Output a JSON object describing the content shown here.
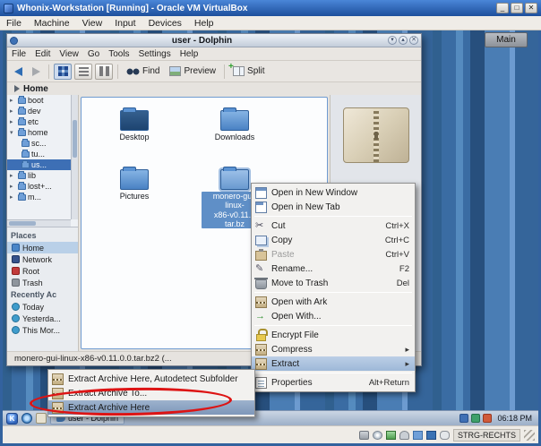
{
  "vbox": {
    "title": "Whonix-Workstation [Running] - Oracle VM VirtualBox",
    "menu": [
      "File",
      "Machine",
      "View",
      "Input",
      "Devices",
      "Help"
    ],
    "host_key": "STRG-RECHTS"
  },
  "desktop": {
    "main_button": "Main"
  },
  "dolphin": {
    "title": "user - Dolphin",
    "menu": [
      "File",
      "Edit",
      "View",
      "Go",
      "Tools",
      "Settings",
      "Help"
    ],
    "toolbar": {
      "find": "Find",
      "preview": "Preview",
      "split": "Split"
    },
    "breadcrumb": "Home",
    "tree": [
      {
        "label": "boot"
      },
      {
        "label": "dev"
      },
      {
        "label": "etc"
      },
      {
        "label": "home"
      },
      {
        "label": "sc..."
      },
      {
        "label": "tu..."
      },
      {
        "label": "us..."
      },
      {
        "label": "lib"
      },
      {
        "label": "lost+..."
      },
      {
        "label": "m..."
      }
    ],
    "places": {
      "header": "Places",
      "items": [
        "Home",
        "Network",
        "Root",
        "Trash"
      ],
      "recent_header": "Recently Ac",
      "recent_items": [
        "Today",
        "Yesterda...",
        "This Mor..."
      ]
    },
    "files": [
      {
        "label": "Desktop"
      },
      {
        "label": "Downloads"
      },
      {
        "label": "Pictures"
      },
      {
        "label": "monero-gui-linux-\nx86-v0.11...\ntar.bz"
      }
    ],
    "status": "monero-gui-linux-x86-v0.11.0.0.tar.bz2 (..."
  },
  "context_menu": {
    "items": [
      {
        "label": "Open in New Window"
      },
      {
        "label": "Open in New Tab"
      },
      {
        "separator": true
      },
      {
        "label": "Cut",
        "shortcut": "Ctrl+X"
      },
      {
        "label": "Copy",
        "shortcut": "Ctrl+C"
      },
      {
        "label": "Paste",
        "shortcut": "Ctrl+V",
        "disabled": true
      },
      {
        "label": "Rename...",
        "shortcut": "F2"
      },
      {
        "label": "Move to Trash",
        "shortcut": "Del"
      },
      {
        "separator": true
      },
      {
        "label": "Open with Ark"
      },
      {
        "label": "Open With..."
      },
      {
        "separator": true
      },
      {
        "label": "Encrypt File"
      },
      {
        "label": "Compress",
        "submenu": true
      },
      {
        "label": "Extract",
        "submenu": true,
        "highlighted": true
      },
      {
        "separator": true
      },
      {
        "label": "Properties",
        "shortcut": "Alt+Return"
      }
    ]
  },
  "extract_submenu": {
    "items": [
      {
        "label": "Extract Archive Here, Autodetect Subfolder"
      },
      {
        "label": "Extract Archive To..."
      },
      {
        "label": "Extract Archive Here",
        "highlighted": true
      }
    ]
  },
  "taskbar": {
    "task": "user - Dolphin",
    "clock": "06:18 PM"
  },
  "colors": {
    "selection": "#5f8fc7",
    "annotation": "#dd1414",
    "desktop_blue": "#3a6ca3"
  }
}
